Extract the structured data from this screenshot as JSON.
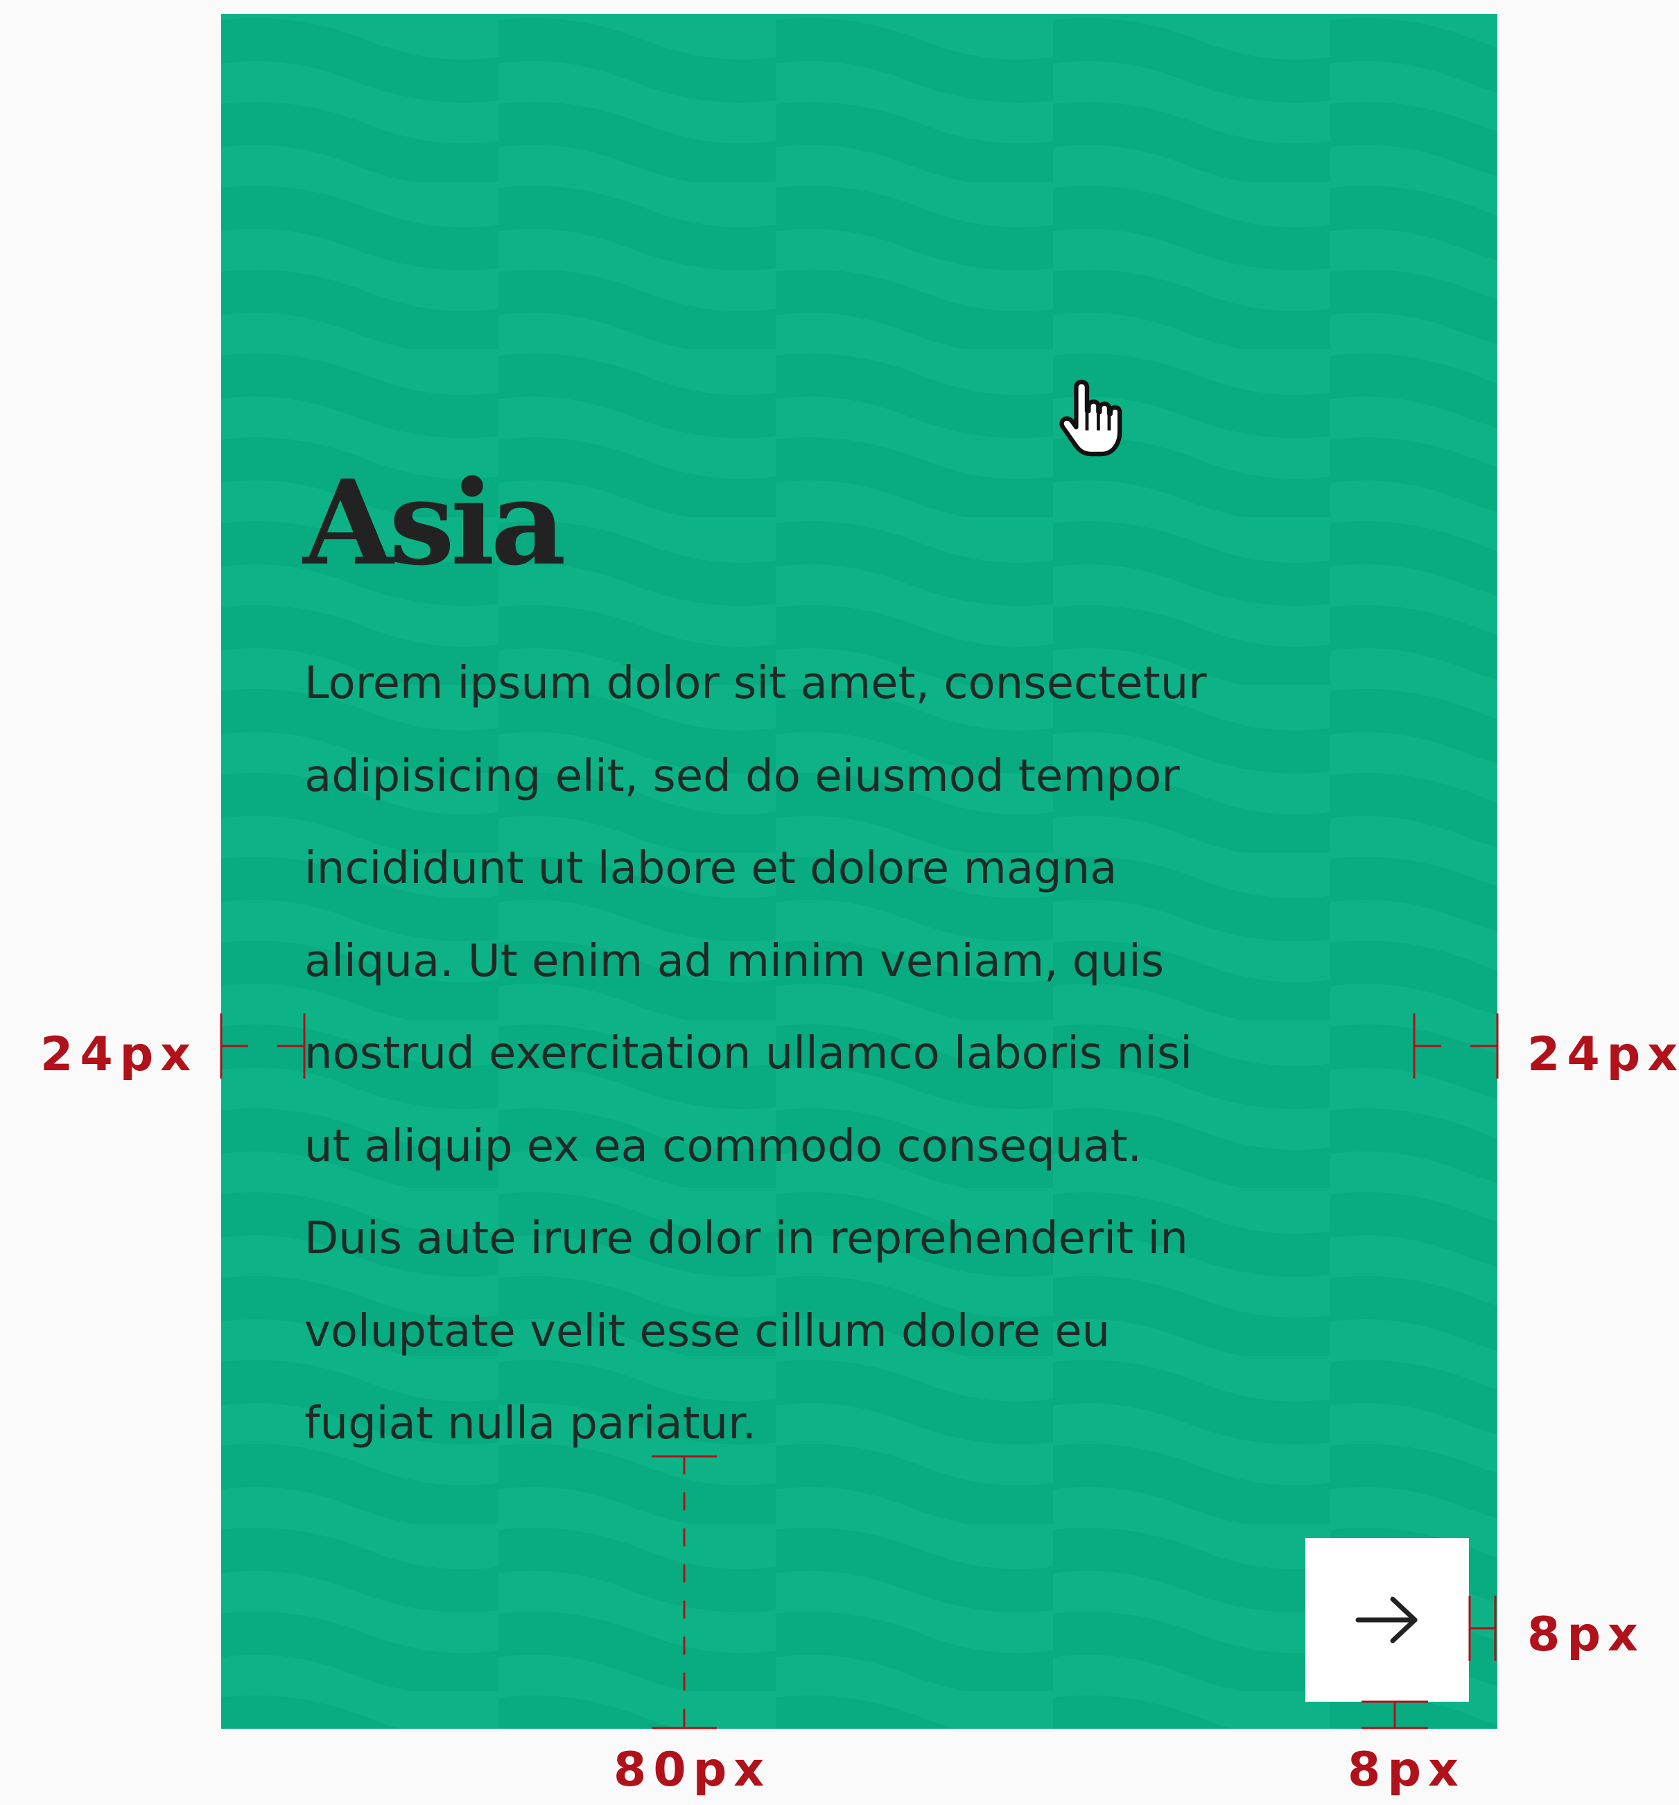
{
  "card": {
    "title": "Asia",
    "body": "Lorem ipsum dolor sit amet, consectetur\nadipisicing elit, sed do eiusmod tempor\nincididunt ut labore et dolore magna\naliqua. Ut enim ad minim veniam, quis\nnostrud exercitation ullamco laboris nisi\nut aliquip ex ea commodo consequat.\nDuis aute irure dolor in reprehenderit in\nvoluptate velit esse cillum dolore eu\nfugiat nulla pariatur.",
    "next_icon": "arrow-right-icon",
    "background_color": "#0db386",
    "pattern": "wave-stripes"
  },
  "annotations": {
    "left_padding": "24px",
    "right_padding": "24px",
    "button_right_offset": "8px",
    "text_bottom_gap": "80px",
    "button_bottom_offset": "8px",
    "color": "#b0111a"
  },
  "cursor_icon": "pointer-hand-icon"
}
